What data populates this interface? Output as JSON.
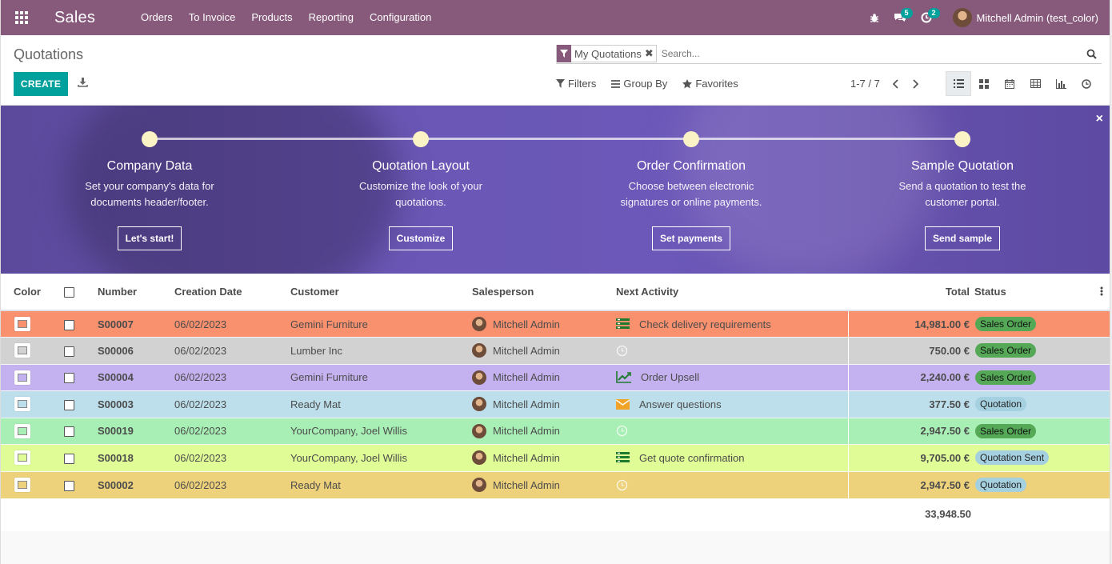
{
  "navbar": {
    "app_name": "Sales",
    "menu": [
      "Orders",
      "To Invoice",
      "Products",
      "Reporting",
      "Configuration"
    ],
    "messages_count": "5",
    "activities_count": "2",
    "user_name": "Mitchell Admin (test_color)",
    "color": "#875a7b"
  },
  "control_panel": {
    "breadcrumb": "Quotations",
    "create_label": "CREATE",
    "facet_label": "My Quotations",
    "facet_remove": "✖",
    "search_placeholder": "Search...",
    "filters_label": "Filters",
    "groupby_label": "Group By",
    "favorites_label": "Favorites",
    "pager": "1-7 / 7"
  },
  "banner": {
    "close": "×",
    "steps": [
      {
        "title": "Company Data",
        "desc1": "Set your company's data for",
        "desc2": "documents header/footer.",
        "button": "Let's start!"
      },
      {
        "title": "Quotation Layout",
        "desc1": "Customize the look of your",
        "desc2": "quotations.",
        "button": "Customize"
      },
      {
        "title": "Order Confirmation",
        "desc1": "Choose between electronic",
        "desc2": "signatures or online payments.",
        "button": "Set payments"
      },
      {
        "title": "Sample Quotation",
        "desc1": "Send a quotation to test the",
        "desc2": "customer portal.",
        "button": "Send sample"
      }
    ]
  },
  "table": {
    "headers": {
      "color": "Color",
      "number": "Number",
      "creation_date": "Creation Date",
      "customer": "Customer",
      "salesperson": "Salesperson",
      "next_activity": "Next Activity",
      "total": "Total",
      "status": "Status"
    },
    "rows": [
      {
        "number": "S00007",
        "date": "06/02/2023",
        "customer": "Gemini Furniture",
        "salesperson": "Mitchell Admin",
        "activity": "Check delivery requirements",
        "activity_icon": "tasks-icon",
        "total": "14,981.00 €",
        "status": "Sales Order",
        "row_color": "#f9906e"
      },
      {
        "number": "S00006",
        "date": "06/02/2023",
        "customer": "Lumber Inc",
        "salesperson": "Mitchell Admin",
        "activity": "",
        "activity_icon": "clock-icon",
        "total": "750.00 €",
        "status": "Sales Order",
        "row_color": "#d3d2d2"
      },
      {
        "number": "S00004",
        "date": "06/02/2023",
        "customer": "Gemini Furniture",
        "salesperson": "Mitchell Admin",
        "activity": "Order Upsell",
        "activity_icon": "chart-line-icon",
        "total": "2,240.00 €",
        "status": "Sales Order",
        "row_color": "#c4b1ef"
      },
      {
        "number": "S00003",
        "date": "06/02/2023",
        "customer": "Ready Mat",
        "salesperson": "Mitchell Admin",
        "activity": "Answer questions",
        "activity_icon": "envelope-icon",
        "total": "377.50 €",
        "status": "Quotation",
        "row_color": "#bcdfeb"
      },
      {
        "number": "S00019",
        "date": "06/02/2023",
        "customer": "YourCompany, Joel Willis",
        "salesperson": "Mitchell Admin",
        "activity": "",
        "activity_icon": "clock-icon",
        "total": "2,947.50 €",
        "status": "Sales Order",
        "row_color": "#a8efb5"
      },
      {
        "number": "S00018",
        "date": "06/02/2023",
        "customer": "YourCompany, Joel Willis",
        "salesperson": "Mitchell Admin",
        "activity": "Get quote confirmation",
        "activity_icon": "tasks-icon",
        "total": "9,705.00 €",
        "status": "Quotation Sent",
        "row_color": "#e0fc97"
      },
      {
        "number": "S00002",
        "date": "06/02/2023",
        "customer": "Ready Mat",
        "salesperson": "Mitchell Admin",
        "activity": "",
        "activity_icon": "clock-icon",
        "total": "2,947.50 €",
        "status": "Quotation",
        "row_color": "#eed27b"
      }
    ],
    "grand_total": "33,948.50"
  }
}
